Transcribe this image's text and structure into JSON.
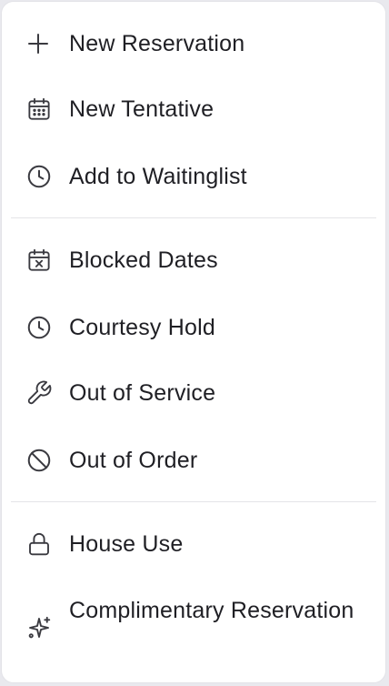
{
  "menu": {
    "items": [
      {
        "label": "New Reservation",
        "icon": "plus-icon"
      },
      {
        "label": "New Tentative",
        "icon": "calendar-icon"
      },
      {
        "label": "Add to Waitinglist",
        "icon": "clock-icon"
      },
      {
        "label": "Blocked Dates",
        "icon": "calendar-x-icon"
      },
      {
        "label": "Courtesy Hold",
        "icon": "clock-icon"
      },
      {
        "label": "Out of Service",
        "icon": "wrench-icon"
      },
      {
        "label": "Out of Order",
        "icon": "ban-icon"
      },
      {
        "label": "House Use",
        "icon": "lock-icon"
      },
      {
        "label": "Complimentary Reservation",
        "icon": "sparkles-icon"
      }
    ]
  },
  "colors": {
    "text": "#1f1f24",
    "icon": "#3a3a40",
    "divider": "#e4e4e8",
    "background": "#ffffff"
  }
}
